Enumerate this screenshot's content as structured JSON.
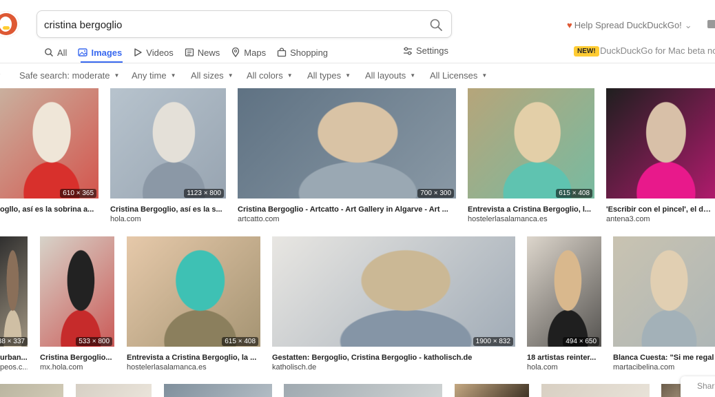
{
  "search": {
    "query": "cristina bergoglio"
  },
  "header": {
    "promo_text": "Help Spread DuckDuckGo!",
    "new_badge": "NEW!",
    "new_text": "DuckDuckGo for Mac beta now"
  },
  "nav": {
    "tabs": [
      {
        "label": "All",
        "icon": "search-icon"
      },
      {
        "label": "Images",
        "icon": "image-icon"
      },
      {
        "label": "Videos",
        "icon": "play-icon"
      },
      {
        "label": "News",
        "icon": "newspaper-icon"
      },
      {
        "label": "Maps",
        "icon": "map-pin-icon"
      },
      {
        "label": "Shopping",
        "icon": "shopping-bag-icon"
      }
    ],
    "settings_label": "Settings",
    "active_tab": "Images"
  },
  "filters": [
    "Safe search: moderate",
    "Any time",
    "All sizes",
    "All colors",
    "All types",
    "All layouts",
    "All Licenses"
  ],
  "results": {
    "row1": [
      {
        "title": "ogllo, así es la sobrina a...",
        "source": "",
        "dims": "610 × 365",
        "colors": [
          "#c9b2a0",
          "#d8302c",
          "#efe6d8"
        ]
      },
      {
        "title": "Cristina Bergoglio, así es la s...",
        "source": "hola.com",
        "dims": "1123 × 800",
        "colors": [
          "#b7c3cd",
          "#8b98a6",
          "#e4e0d8"
        ]
      },
      {
        "title": "Cristina Bergoglio - Artcatto - Art Gallery in Algarve - Art ...",
        "source": "artcatto.com",
        "dims": "700 × 300",
        "colors": [
          "#5f7283",
          "#9aa8b3",
          "#d9c3a5"
        ]
      },
      {
        "title": "Entrevista a Cristina Bergoglio, l...",
        "source": "hostelerlasalamanca.es",
        "dims": "615 × 408",
        "colors": [
          "#b6a57a",
          "#5fc3b0",
          "#e3cfa8"
        ]
      },
      {
        "title": "'Escribir con el pincel', el docu",
        "source": "antena3.com",
        "dims": "",
        "colors": [
          "#1f1f1f",
          "#e8198b",
          "#d8c0a8"
        ]
      }
    ],
    "row2": [
      {
        "title": "urban...",
        "source": "peos.c...",
        "dims": "38 × 337",
        "colors": [
          "#2b2b2b",
          "#cfbfa4",
          "#8a6f59"
        ]
      },
      {
        "title": "Cristina Bergoglio...",
        "source": "mx.hola.com",
        "dims": "533 × 800",
        "colors": [
          "#d7d3c9",
          "#c62b2b",
          "#222222"
        ]
      },
      {
        "title": "Entrevista a Cristina Bergoglio, la ...",
        "source": "hostelerlasalamanca.es",
        "dims": "615 × 408",
        "colors": [
          "#e6c9aa",
          "#8b7f5d",
          "#3ec1b4"
        ]
      },
      {
        "title": "Gestatten: Bergoglio, Cristina Bergoglio - katholisch.de",
        "source": "katholisch.de",
        "dims": "1900 × 832",
        "colors": [
          "#e8e6e2",
          "#8595a6",
          "#cbb895"
        ]
      },
      {
        "title": "18 artistas reinter...",
        "source": "hola.com",
        "dims": "494 × 650",
        "colors": [
          "#ddd6cc",
          "#1f1f1f",
          "#d9b88d"
        ]
      },
      {
        "title": "Blanca Cuesta: \"Si me regal",
        "source": "martacibelina.com",
        "dims": "",
        "colors": [
          "#c9c3b1",
          "#a3b1b8",
          "#e1cfb2"
        ]
      }
    ],
    "row3": [
      {
        "colors": [
          "#b8b39e",
          "#d1cab6"
        ]
      },
      {
        "colors": [
          "#d6cfc4",
          "#eae4da"
        ]
      },
      {
        "colors": [
          "#7f8f9c",
          "#b2bcc4"
        ]
      },
      {
        "colors": [
          "#9fa9b0",
          "#cfd3d3"
        ]
      },
      {
        "colors": [
          "#c4a882",
          "#3f3325"
        ]
      },
      {
        "colors": [
          "#d8cfc2",
          "#e8e2d8"
        ]
      },
      {
        "colors": [
          "#6a5b49",
          "#c9b79c"
        ]
      }
    ]
  },
  "share_label": "Shar"
}
